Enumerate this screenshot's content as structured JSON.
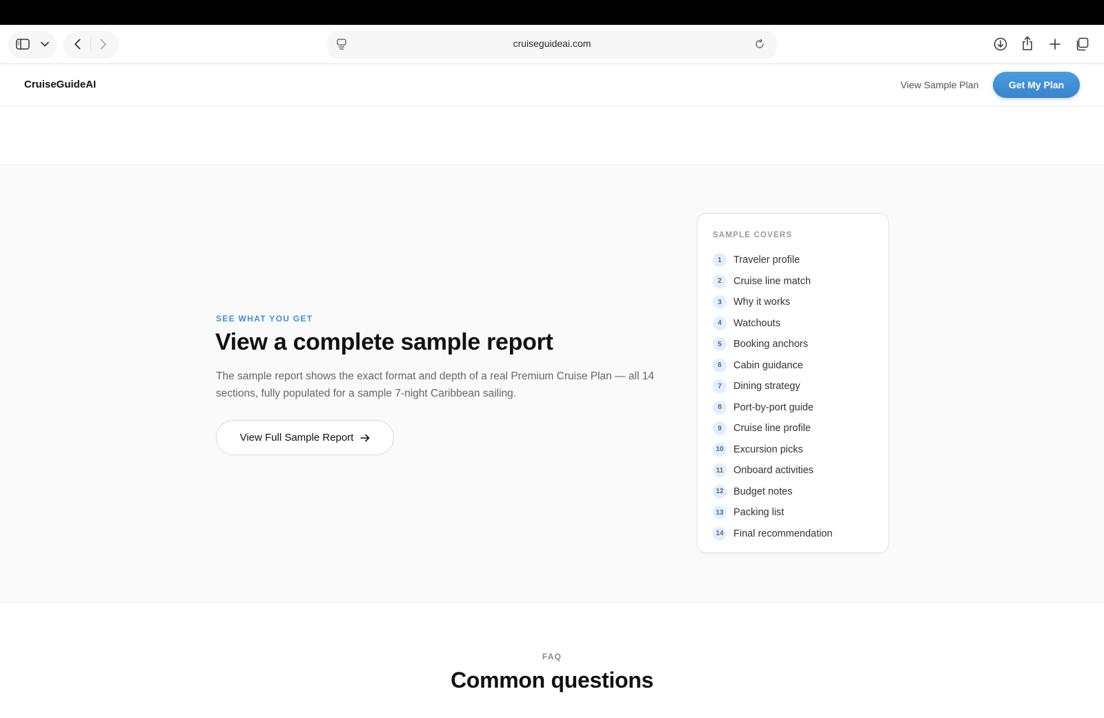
{
  "browser": {
    "url": "cruiseguideai.com"
  },
  "header": {
    "logo": "CruiseGuideAI",
    "view_sample_link": "View Sample Plan",
    "cta_label": "Get My Plan"
  },
  "sample": {
    "eyebrow": "SEE WHAT YOU GET",
    "title": "View a complete sample report",
    "description": "The sample report shows the exact format and depth of a real Premium Cruise Plan — all 14 sections, fully populated for a sample 7-night Caribbean sailing.",
    "button_label": "View Full Sample Report",
    "covers_title": "SAMPLE COVERS",
    "covers": [
      {
        "num": "1",
        "label": "Traveler profile"
      },
      {
        "num": "2",
        "label": "Cruise line match"
      },
      {
        "num": "3",
        "label": "Why it works"
      },
      {
        "num": "4",
        "label": "Watchouts"
      },
      {
        "num": "5",
        "label": "Booking anchors"
      },
      {
        "num": "6",
        "label": "Cabin guidance"
      },
      {
        "num": "7",
        "label": "Dining strategy"
      },
      {
        "num": "8",
        "label": "Port-by-port guide"
      },
      {
        "num": "9",
        "label": "Cruise line profile"
      },
      {
        "num": "10",
        "label": "Excursion picks"
      },
      {
        "num": "11",
        "label": "Onboard activities"
      },
      {
        "num": "12",
        "label": "Budget notes"
      },
      {
        "num": "13",
        "label": "Packing list"
      },
      {
        "num": "14",
        "label": "Final recommendation"
      }
    ]
  },
  "faq": {
    "eyebrow": "FAQ",
    "title": "Common questions"
  },
  "colors": {
    "accent": "#3f8fd6",
    "cta": "#3a84cc",
    "badge_bg": "#e4eefa",
    "section_bg": "#fafafa"
  },
  "icons": [
    "sidebar-icon",
    "chevron-down-icon",
    "back-icon",
    "forward-icon",
    "page-menu-icon",
    "reload-icon",
    "download-icon",
    "share-icon",
    "new-tab-icon",
    "tabs-overview-icon",
    "arrow-right-icon"
  ]
}
